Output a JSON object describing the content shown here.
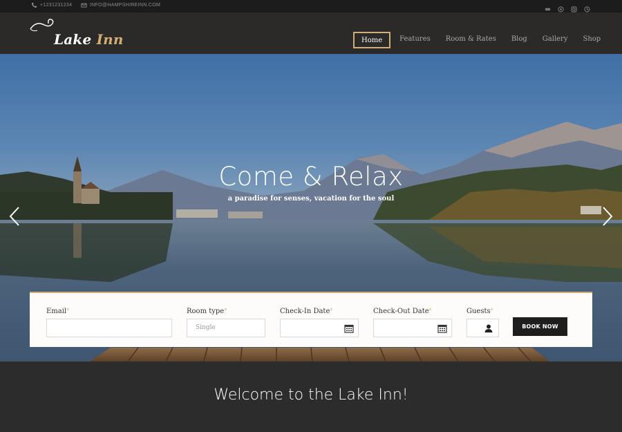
{
  "topbar": {
    "phone": "+1231231234",
    "email": "INFO@HAMPSHIREINN.COM",
    "socials": [
      "tripadvisor-icon",
      "foursquare-icon",
      "instagram-icon",
      "yelp-icon"
    ]
  },
  "header": {
    "logo_main": "Lake",
    "logo_accent": "Inn",
    "nav": [
      "Home",
      "Features",
      "Room & Rates",
      "Blog",
      "Gallery",
      "Shop"
    ],
    "active_nav": "Home"
  },
  "hero": {
    "title": "Come & Relax",
    "subtitle": "a paradise for senses, vacation for the soul"
  },
  "booking": {
    "email_label": "Email",
    "room_type_label": "Room type",
    "room_type_value": "Single",
    "checkin_label": "Check-In Date",
    "checkout_label": "Check-Out Date",
    "guests_label": "Guests",
    "required_mark": "*",
    "book_label": "BOOK NOW"
  },
  "welcome": {
    "heading": "Welcome to the Lake Inn!"
  },
  "colors": {
    "accent": "#d2ad78",
    "topbar": "#1c1c1c",
    "header": "#2b2a29",
    "button": "#1e1e1e"
  }
}
